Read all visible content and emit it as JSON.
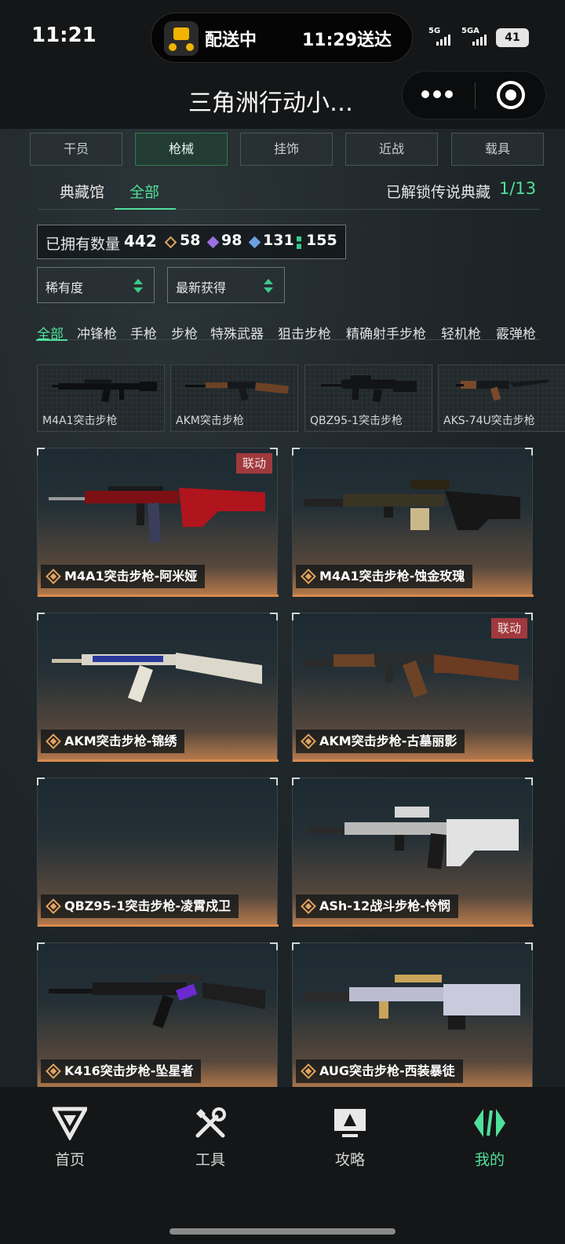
{
  "status_bar": {
    "time": "11:21",
    "delivery_status": "配送中",
    "delivery_eta": "11:29送达",
    "network_1": "5G",
    "network_2": "5GA",
    "battery": "41"
  },
  "title_bar": {
    "title": "三角洲行动小…"
  },
  "category_tabs": [
    {
      "label": "干员",
      "active": false
    },
    {
      "label": "枪械",
      "active": true
    },
    {
      "label": "挂饰",
      "active": false
    },
    {
      "label": "近战",
      "active": false
    },
    {
      "label": "载具",
      "active": false
    }
  ],
  "sub_tabs": [
    {
      "label": "典藏馆",
      "active": false
    },
    {
      "label": "全部",
      "active": true
    }
  ],
  "legendary": {
    "label": "已解锁传说典藏",
    "count": "1/13"
  },
  "owned": {
    "label": "已拥有数量",
    "total": "442",
    "counts": [
      {
        "icon": "orange-rarity-icon",
        "value": "58",
        "color": "#e3a35d"
      },
      {
        "icon": "purple-rarity-icon",
        "value": "98",
        "color": "#9a6fe0"
      },
      {
        "icon": "blue-rarity-icon",
        "value": "131",
        "color": "#6d9fe0"
      },
      {
        "icon": "green-rarity-icon",
        "value": "155",
        "color": "#3bc98a"
      }
    ]
  },
  "sort_selects": [
    {
      "label": "稀有度"
    },
    {
      "label": "最新获得"
    }
  ],
  "weapon_filters": [
    {
      "label": "全部",
      "active": true
    },
    {
      "label": "冲锋枪",
      "active": false
    },
    {
      "label": "手枪",
      "active": false
    },
    {
      "label": "步枪",
      "active": false
    },
    {
      "label": "特殊武器",
      "active": false
    },
    {
      "label": "狙击步枪",
      "active": false
    },
    {
      "label": "精确射手步枪",
      "active": false
    },
    {
      "label": "轻机枪",
      "active": false
    },
    {
      "label": "霰弹枪",
      "active": false
    }
  ],
  "base_weapons": [
    {
      "label": "M4A1突击步枪"
    },
    {
      "label": "AKM突击步枪"
    },
    {
      "label": "QBZ95-1突击步枪"
    },
    {
      "label": "AKS-74U突击步枪"
    }
  ],
  "skins": [
    {
      "label": "M4A1突击步枪-阿米娅",
      "badge": "联动"
    },
    {
      "label": "M4A1突击步枪-蚀金玫瑰",
      "badge": ""
    },
    {
      "label": "AKM突击步枪-锦绣",
      "badge": ""
    },
    {
      "label": "AKM突击步枪-古墓丽影",
      "badge": "联动"
    },
    {
      "label": "QBZ95-1突击步枪-凌霄戍卫",
      "badge": ""
    },
    {
      "label": "ASh-12战斗步枪-怜悯",
      "badge": ""
    },
    {
      "label": "K416突击步枪-坠星者",
      "badge": ""
    },
    {
      "label": "AUG突击步枪-西装暴徒",
      "badge": ""
    }
  ],
  "bottom_nav": [
    {
      "label": "首页",
      "icon": "brand-logo-icon",
      "active": false
    },
    {
      "label": "工具",
      "icon": "tools-icon",
      "active": false
    },
    {
      "label": "攻略",
      "icon": "guide-monitor-icon",
      "active": false
    },
    {
      "label": "我的",
      "icon": "profile-logo-icon",
      "active": true
    }
  ],
  "colors": {
    "accent": "#4fe09a",
    "collab_badge": "#a0393d",
    "card_glow": "#d9894e"
  }
}
